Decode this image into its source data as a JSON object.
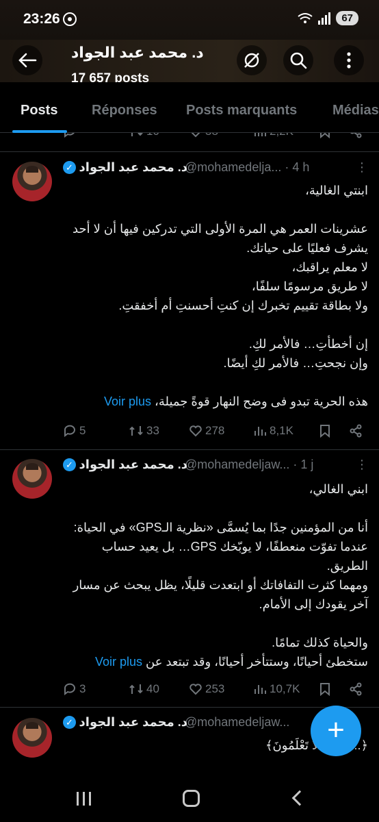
{
  "status_bar": {
    "time": "23:26",
    "battery": "67"
  },
  "header": {
    "title": "د. محمد عبد الجواد",
    "posts_count": "17 657 posts"
  },
  "tabs": [
    "Posts",
    "Réponses",
    "Posts marquants",
    "Médias"
  ],
  "partial_row": {
    "retweets": "10",
    "likes": "58",
    "views": "2,2K"
  },
  "tweets": [
    {
      "name": "د. محمد عبد الجواد",
      "handle": "@mohamedelja...",
      "time": "· 4 h",
      "body": "ابنتي الغالية،\n\nعشرينات العمر هي المرة الأولى التي تدركين فيها أن لا أحد يشرف فعليًا على حياتك.\nلا معلم يراقبك،\nلا طريق مرسومًا سلفًا،\nولا بطاقة تقييم تخبرك إن كنتِ أحسنتِ أم أخفقتِ.\n\nإن أخطأتِ… فالأمر لكِ.\nوإن نجحتِ… فالأمر لكِ أيضًا.\n\nهذه الحرية تبدو فى وضح النهار قوةً جميلة،",
      "voir_plus": "Voir plus",
      "replies": "5",
      "retweets": "33",
      "likes": "278",
      "views": "8,1K"
    },
    {
      "name": "د. محمد عبد الجواد",
      "handle": "@mohamedeljaw...",
      "time": "· 1 j",
      "body": "ابني الغالي،\n\nأنا من المؤمنين جدًا بما يُسمَّى «نظرية الـGPS» في الحياة:\nعندما تفوّت منعطفًا، لا يوبّخك GPS… بل يعيد حساب الطريق.\nومهما كثرت التفافاتك أو ابتعدت قليلًا، يظل يبحث عن مسار آخر يقودك إلى الأمام.\n\nوالحياة كذلك تمامًا.\nستخطئ أحيانًا، وستتأخر أحيانًا، وقد تبتعد عن",
      "voir_plus": "Voir plus",
      "replies": "3",
      "retweets": "40",
      "likes": "253",
      "views": "10,7K"
    },
    {
      "name": "د. محمد عبد الجواد",
      "handle": "@mohamedeljaw...",
      "body": "﴿... وَأَنتُمْ لَا تَعْلَمُونَ﴾"
    }
  ],
  "fab": {
    "label": "+"
  },
  "colors": {
    "accent": "#1d9bf0",
    "text": "#e7e9ea",
    "muted": "#71767b",
    "background": "#000000"
  }
}
